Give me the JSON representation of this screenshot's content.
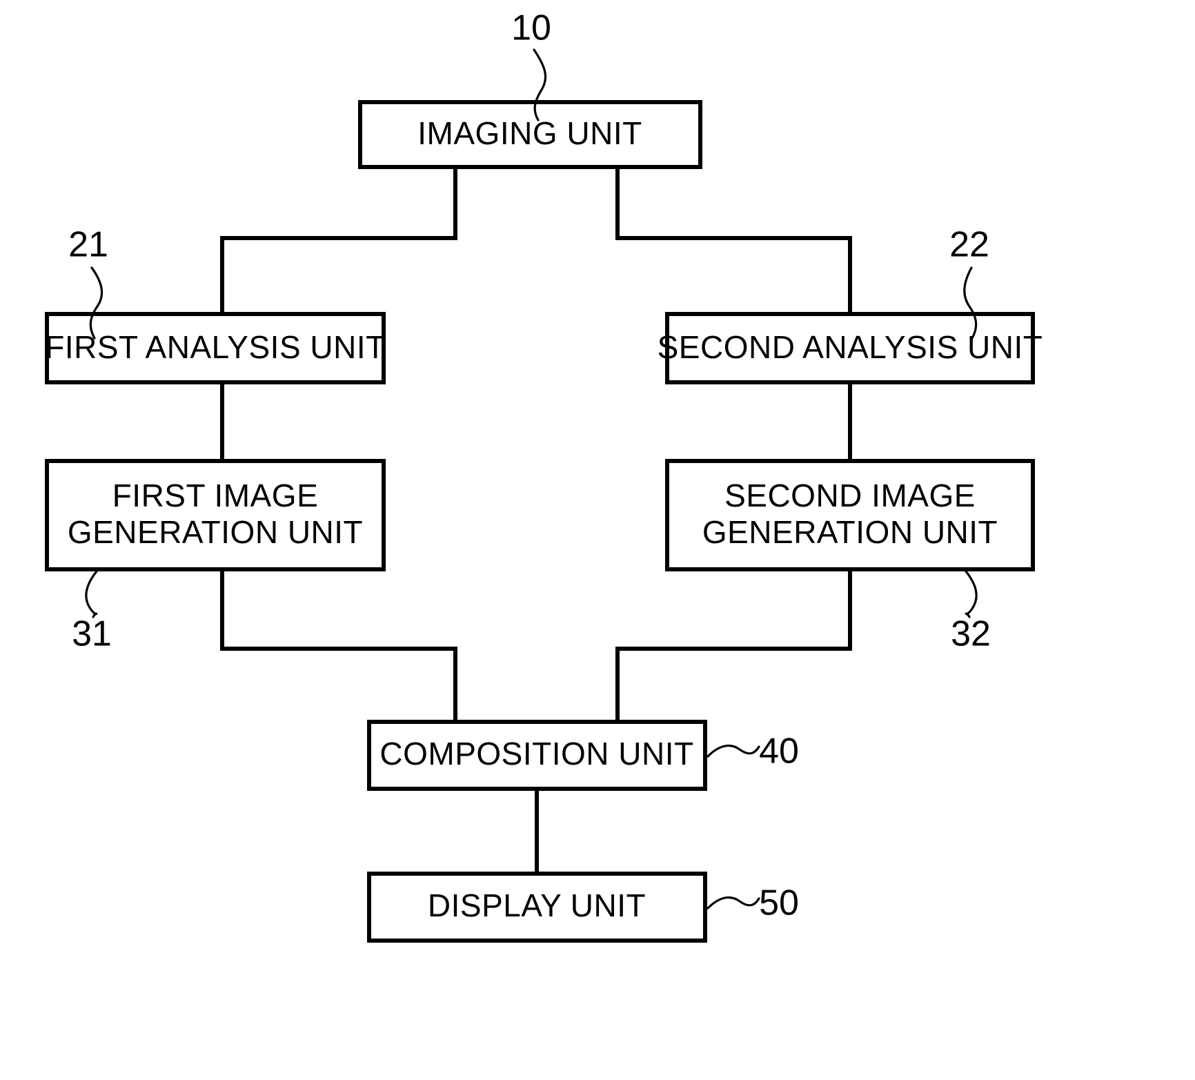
{
  "diagram": {
    "type": "patent-block-diagram",
    "blocks": [
      {
        "id": "imaging",
        "label": "IMAGING UNIT",
        "ref": "10"
      },
      {
        "id": "first-analysis",
        "label": "FIRST ANALYSIS UNIT",
        "ref": "21"
      },
      {
        "id": "second-analysis",
        "label": "SECOND ANALYSIS UNIT",
        "ref": "22"
      },
      {
        "id": "first-image-generation",
        "label_line1": "FIRST IMAGE",
        "label_line2": "GENERATION UNIT",
        "ref": "31"
      },
      {
        "id": "second-image-generation",
        "label_line1": "SECOND IMAGE",
        "label_line2": "GENERATION UNIT",
        "ref": "32"
      },
      {
        "id": "composition",
        "label": "COMPOSITION UNIT",
        "ref": "40"
      },
      {
        "id": "display",
        "label": "DISPLAY UNIT",
        "ref": "50"
      }
    ],
    "colors": {
      "line": "#000000",
      "background": "#ffffff",
      "text": "#000000"
    }
  }
}
